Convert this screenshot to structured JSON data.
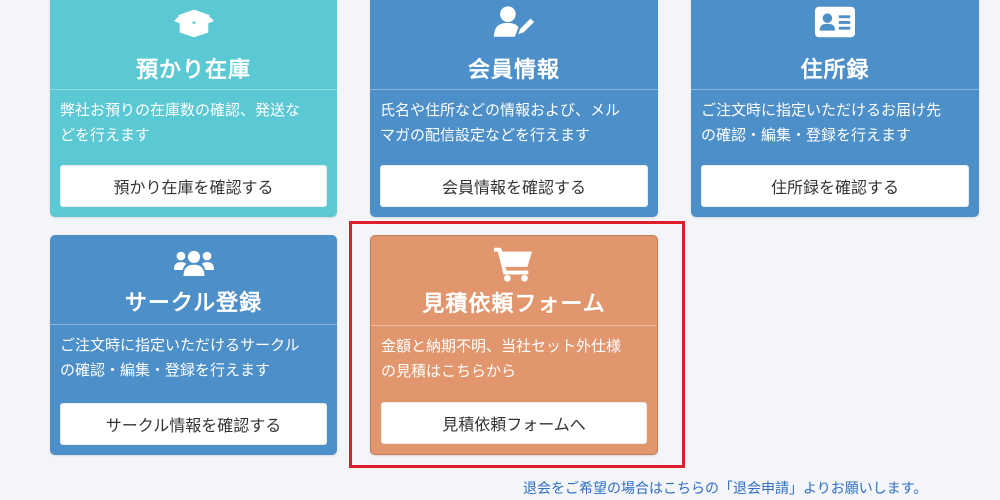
{
  "cards": [
    {
      "icon": "box-open-icon",
      "title": "預かり在庫",
      "description_lines": [
        "弊社お預りの在庫数の確認、発送な",
        "どを行えます"
      ],
      "button": "預かり在庫を確認する",
      "color": "#5bc9d3"
    },
    {
      "icon": "user-edit-icon",
      "title": "会員情報",
      "description_lines": [
        "氏名や住所などの情報および、メル",
        "マガの配信設定などを行えます"
      ],
      "button": "会員情報を確認する",
      "color": "#4d8fc8"
    },
    {
      "icon": "address-card-icon",
      "title": "住所録",
      "description_lines": [
        "ご注文時に指定いただけるお届け先",
        "の確認・編集・登録を行えます"
      ],
      "button": "住所録を確認する",
      "color": "#4d8fc8"
    },
    {
      "icon": "users-icon",
      "title": "サークル登録",
      "description_lines": [
        "ご注文時に指定いただけるサークル",
        "の確認・編集・登録を行えます"
      ],
      "button": "サークル情報を確認する",
      "color": "#4d8fc8"
    },
    {
      "icon": "cart-icon",
      "title": "見積依頼フォーム",
      "description_lines": [
        "金額と納期不明、当社セット外仕様",
        "の見積はこちらから"
      ],
      "button": "見積依頼フォームへ",
      "color": "#e2966d"
    }
  ],
  "highlight_color": "#e01e2b",
  "withdraw": {
    "prefix": "退会をご希望の場合はこちらの「",
    "link": "退会申請",
    "suffix": "」よりお願いします。"
  }
}
